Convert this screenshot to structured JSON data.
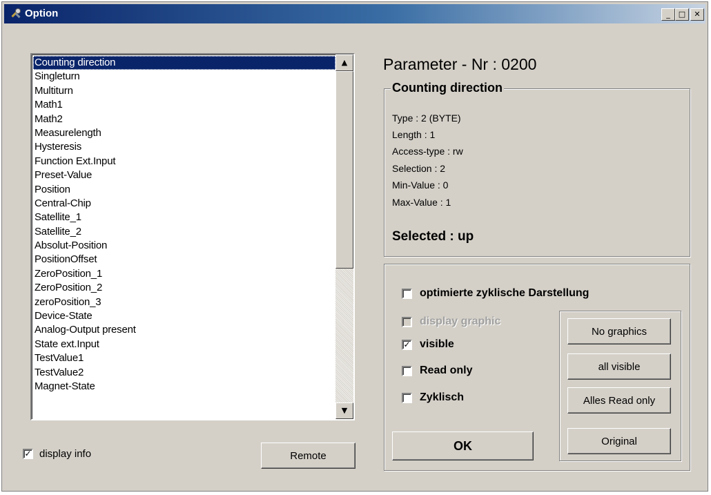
{
  "window": {
    "title": "Option",
    "controls": {
      "minimize": "_",
      "maximize": "□",
      "close": "✕"
    },
    "icon": "tools-icon"
  },
  "list": {
    "selected_index": 0,
    "items": [
      "Counting direction",
      "Singleturn",
      "Multiturn",
      "Math1",
      "Math2",
      "Measurelength",
      "Hysteresis",
      "Function Ext.Input",
      "Preset-Value",
      "Position",
      "Central-Chip",
      "Satellite_1",
      "Satellite_2",
      "Absolut-Position",
      "PositionOffset",
      "ZeroPosition_1",
      "ZeroPosition_2",
      "zeroPosition_3",
      "Device-State",
      "Analog-Output present",
      "State ext.Input",
      "TestValue1",
      "TestValue2",
      "Magnet-State"
    ],
    "scroll_up": "▲",
    "scroll_down": "▼"
  },
  "display_info": {
    "label": "display info",
    "checked": "✓"
  },
  "remote_button": "Remote",
  "parameter": {
    "title": "Parameter - Nr : 0200",
    "group_title": "Counting direction",
    "lines": [
      "Type : 2 (BYTE)",
      "Length : 1",
      "Access-type : rw",
      "Selection : 2",
      "Min-Value : 0",
      "Max-Value : 1"
    ],
    "selected": "Selected : up"
  },
  "options": {
    "optimized": {
      "label": "optimierte zyklische Darstellung",
      "mark": ""
    },
    "display_graphic": {
      "label": "display graphic",
      "mark": ""
    },
    "visible": {
      "label": "visible",
      "mark": "✓"
    },
    "read_only": {
      "label": "Read only",
      "mark": ""
    },
    "zyklisch": {
      "label": "Zyklisch",
      "mark": ""
    }
  },
  "buttons": {
    "ok": "OK",
    "no_graphics": "No graphics",
    "all_visible": "all visible",
    "alles_read_only": "Alles Read only",
    "original": "Original"
  }
}
